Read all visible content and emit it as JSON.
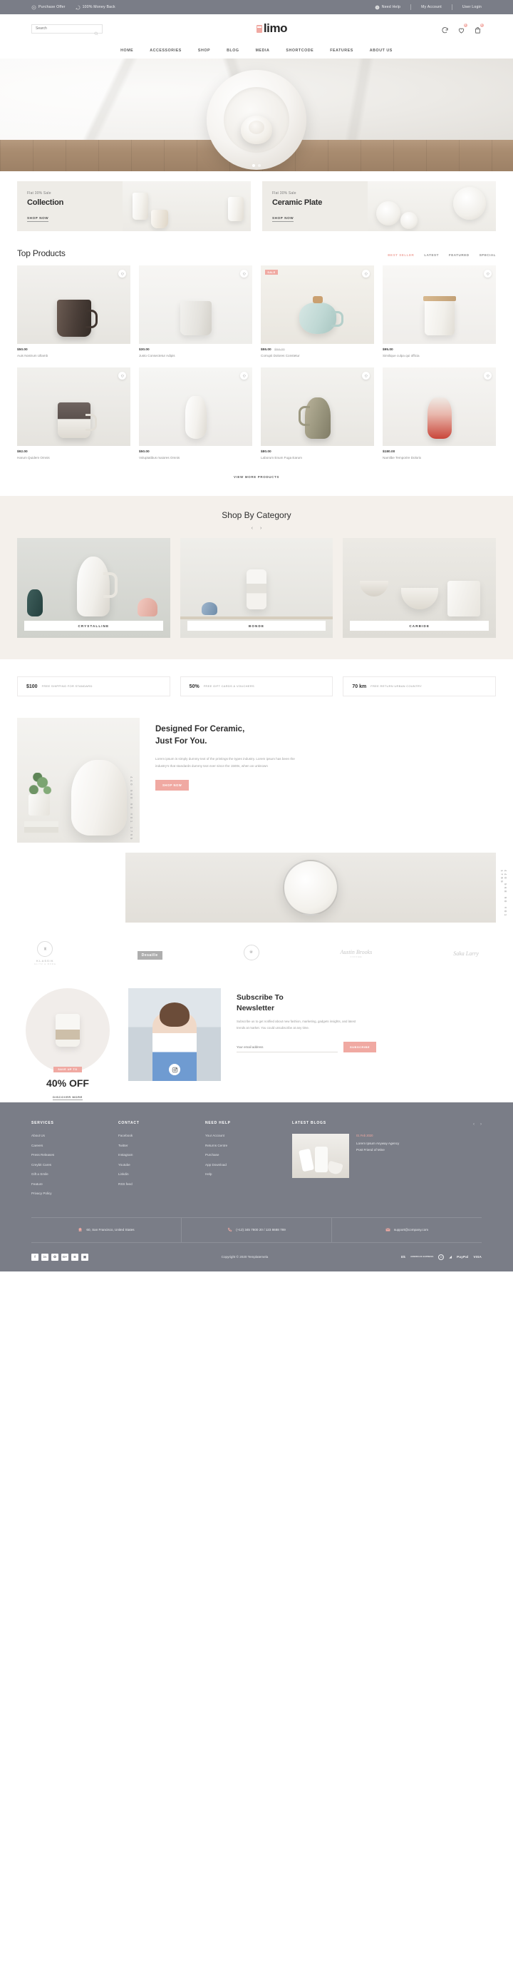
{
  "topbar": {
    "left": [
      {
        "icon": "purchase-icon",
        "label": "Purchase Offer"
      },
      {
        "icon": "money-back-icon",
        "label": "100% Money Back"
      }
    ],
    "right": [
      {
        "icon": "help-icon",
        "label": "Need Help"
      },
      {
        "icon": "",
        "label": "My Account"
      },
      {
        "icon": "",
        "label": "User Login"
      }
    ]
  },
  "header": {
    "search_placeholder": "Search",
    "search_value": "",
    "logo_text": "limo",
    "compare_count": "0",
    "wishlist_count": "0",
    "cart_count": "0"
  },
  "nav": {
    "items": [
      "HOME",
      "ACCESSORIES",
      "SHOP",
      "BLOG",
      "MEDIA",
      "SHORTCODE",
      "FEATURES",
      "ABOUT US"
    ]
  },
  "promos": [
    {
      "sub": "Flat 30% Sale",
      "title": "Collection",
      "link": "SHOP NOW"
    },
    {
      "sub": "Flat 30% Sale",
      "title": "Ceramic Plate",
      "link": "SHOP NOW"
    }
  ],
  "top_products": {
    "title": "Top Products",
    "filters": [
      {
        "label": "BEST SELLER",
        "active": true
      },
      {
        "label": "LATEST",
        "active": false
      },
      {
        "label": "FEATURED",
        "active": false
      },
      {
        "label": "SPECIAL",
        "active": false
      }
    ],
    "view_more": "VIEW MORE PRODUCTS",
    "items": [
      {
        "price": "$50.00",
        "old_price": "",
        "name": "Auis Nostrum Ullamb",
        "badge": ""
      },
      {
        "price": "$30.00",
        "old_price": "",
        "name": "Justo Consectetur Adipis",
        "badge": ""
      },
      {
        "price": "$55.00",
        "old_price": "$58.00",
        "name": "Corrupti Dolores Constetur",
        "badge": "SALE"
      },
      {
        "price": "$95.00",
        "old_price": "",
        "name": "Similique culpa qui officia",
        "badge": ""
      },
      {
        "price": "$92.00",
        "old_price": "",
        "name": "Harum Quidem Omnis",
        "badge": ""
      },
      {
        "price": "$50.00",
        "old_price": "",
        "name": "Voluptatibus maiores Omnis",
        "badge": ""
      },
      {
        "price": "$80.00",
        "old_price": "",
        "name": "Laborum Enum Fuga Earum",
        "badge": ""
      },
      {
        "price": "$180.00",
        "old_price": "",
        "name": "Namlibe Temporire Dolorix",
        "badge": ""
      }
    ]
  },
  "categories": {
    "title": "Shop By Category",
    "prev": "‹",
    "next": "›",
    "items": [
      {
        "label": "CRYSTALLINE"
      },
      {
        "label": "BONDE"
      },
      {
        "label": "CARBIDE"
      }
    ]
  },
  "services": [
    {
      "num": "$100",
      "text": "FREE SHIPPING FOR STANDARD"
    },
    {
      "num": "50%",
      "text": "FREE GIFT CARDS & VOUCHERS"
    },
    {
      "num": "70 km",
      "text": "FREE RETURN URBAN COUNTRY"
    }
  ],
  "designed": {
    "title_line1": "Designed For Ceramic,",
    "title_line2": "Just For You.",
    "body": "Lorem ipsum is simply dummy text of the printings the types industry. Lorem ipsum has been the industry's that standards dummy text ever since the 1500s, when an unknown",
    "button": "SHOP NOW",
    "vrail_left": "440 568 90 #01 1795",
    "vrail_right": "440 568 90 #01 1795"
  },
  "brands": [
    {
      "type": "badge",
      "glyph": "♜",
      "name": "KLASSIK",
      "sub": "GLITZ & MORE"
    },
    {
      "type": "box",
      "name": "Desaille"
    },
    {
      "type": "badge",
      "glyph": "❀",
      "name": "",
      "sub": ""
    },
    {
      "type": "script",
      "name": "Austin Brooks",
      "sub": "COFFEE"
    },
    {
      "type": "script",
      "name": "Saka Larry",
      "sub": ""
    }
  ],
  "newsletter": {
    "save_tag": "SAVE UP TO",
    "off": "40% OFF",
    "link": "DISCOVER MORE",
    "title_line1": "Subscribe To",
    "title_line2": "Newsletter",
    "body": "Subscribe us to get notified about new fashion, marketing, gadgets insights, and latest trends at market. You could unsubscribe at any time.",
    "input_placeholder": "Your email address",
    "input_value": "",
    "button": "SUBSCRIBE"
  },
  "footer": {
    "columns": [
      {
        "heading": "SERVICES",
        "links": [
          "About Us",
          "Careers",
          "Press Releases",
          "Creybit Cares",
          "Gift a Smile",
          "Feature",
          "Privacy Policy"
        ]
      },
      {
        "heading": "CONTACT",
        "links": [
          "Facebook",
          "Twitter",
          "Instagram",
          "Youtube",
          "Linkdin",
          "RSS feed"
        ]
      },
      {
        "heading": "NEED HELP",
        "links": [
          "Your Account",
          "Returns Centre",
          "Purchase",
          "App Download",
          "Help"
        ]
      }
    ],
    "blogs": {
      "heading": "LATEST BLOGS",
      "prev": "‹",
      "next": "›",
      "date": "01 Feb 2020",
      "title_line1": "Lorem Ipsum Anyway Agency",
      "title_line2": "Post Friend of Mine"
    },
    "contact": [
      {
        "icon": "location-icon",
        "text": "60, San Francisco, United States"
      },
      {
        "icon": "phone-icon",
        "text": "(+12) 345 7800 20 / 123 8688 789"
      },
      {
        "icon": "email-icon",
        "text": "support@company.com"
      }
    ],
    "socials": [
      "f",
      "in",
      "✪",
      "G+",
      "B",
      "▣"
    ],
    "copyright": "Copyright © 2020 Templatemela",
    "payments": [
      {
        "label": "Dk",
        "kind": "text"
      },
      {
        "label": "AMERICAN EXPRESS",
        "kind": "small"
      },
      {
        "label": "D",
        "kind": "circle"
      },
      {
        "label": "◢",
        "kind": "mark"
      },
      {
        "label": "PayPal",
        "kind": "text"
      },
      {
        "label": "VISA",
        "kind": "text"
      }
    ]
  },
  "colors": {
    "accent": "#f0a9a2",
    "slate": "#7a7d87",
    "cream": "#f4f0eb"
  }
}
